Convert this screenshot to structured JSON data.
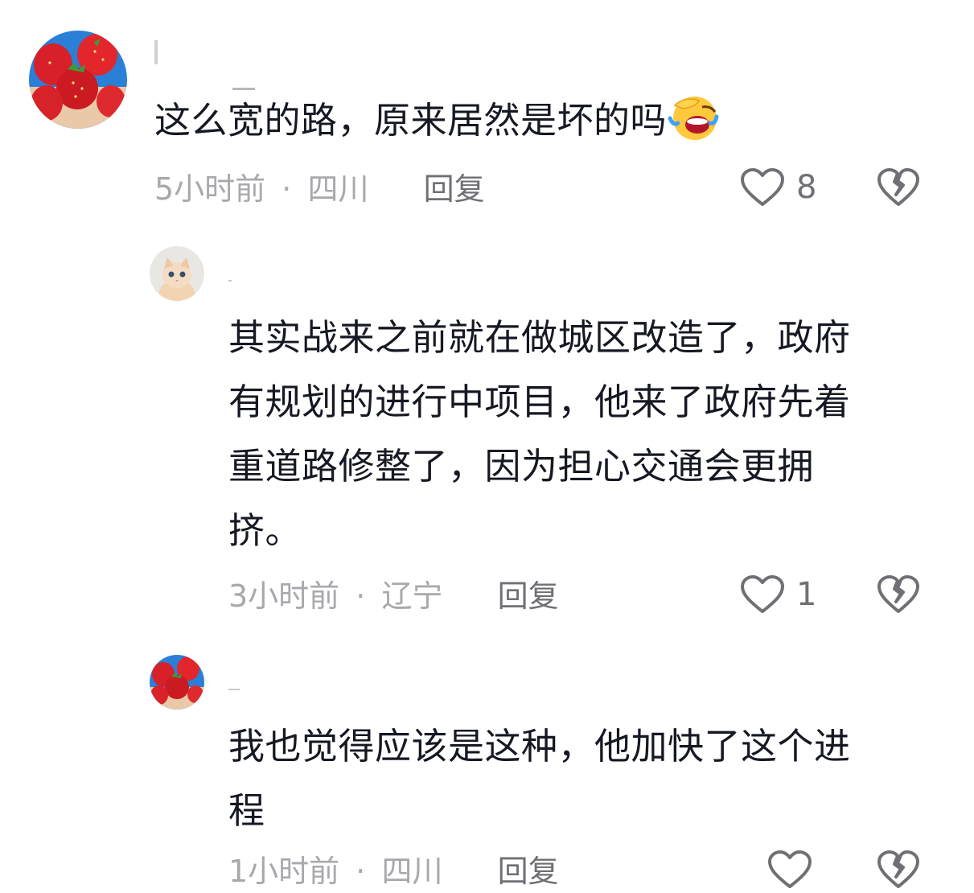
{
  "comments": [
    {
      "text": "这么宽的路，原来居然是坏的吗",
      "emoji": "laughing-crying-emoji",
      "time": "5小时前",
      "location": "四川",
      "separator": "·",
      "reply_label": "回复",
      "like_count": "8",
      "avatar": "strawberries"
    },
    {
      "text_lines": [
        "其实战来之前就在做城区改造了，政府",
        "有规划的进行中项目，他来了政府先着",
        "重道路修整了，因为担心交通会更拥",
        "挤。"
      ],
      "time": "3小时前",
      "location": "辽宁",
      "separator": "·",
      "reply_label": "回复",
      "like_count": "1",
      "avatar": "kitten"
    },
    {
      "text_lines": [
        "我也觉得应该是这种，他加快了这个进",
        "程"
      ],
      "time": "1小时前",
      "location": "四川",
      "separator": "·",
      "reply_label": "回复",
      "avatar": "strawberries"
    }
  ],
  "colors": {
    "text": "#161823",
    "meta": "#a8a8ad",
    "reply": "#6f6f75",
    "strawberry": "#d8202a"
  },
  "icons": {
    "like": "heart-outline-icon",
    "dislike": "broken-heart-icon"
  }
}
